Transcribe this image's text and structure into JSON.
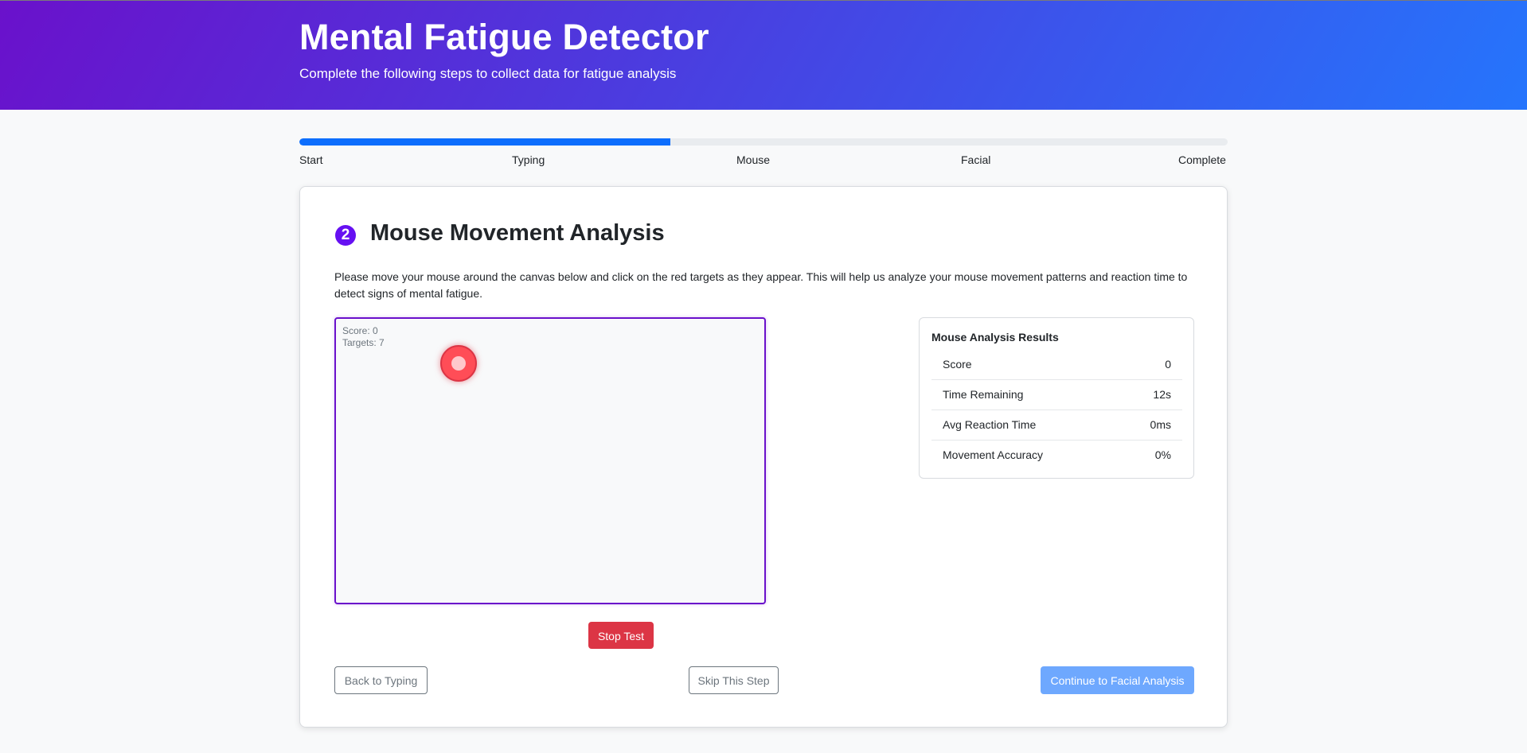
{
  "header": {
    "title": "Mental Fatigue Detector",
    "subtitle": "Complete the following steps to collect data for fatigue analysis"
  },
  "progress": {
    "percent": 40,
    "steps": [
      "Start",
      "Typing",
      "Mouse",
      "Facial",
      "Complete"
    ]
  },
  "section": {
    "step_number": "2",
    "title": "Mouse Movement Analysis",
    "description": "Please move your mouse around the canvas below and click on the red targets as they appear. This will help us analyze your mouse movement patterns and reaction time to detect signs of mental fatigue."
  },
  "canvas": {
    "score_text": "Score: 0",
    "targets_text": "Targets: 7",
    "border_color": "#6a11cb",
    "target_color": "#dc3545"
  },
  "results": {
    "title": "Mouse Analysis Results",
    "rows": [
      {
        "label": "Score",
        "value": "0"
      },
      {
        "label": "Time Remaining",
        "value": "12s"
      },
      {
        "label": "Avg Reaction Time",
        "value": "0ms"
      },
      {
        "label": "Movement Accuracy",
        "value": "0%"
      }
    ]
  },
  "buttons": {
    "stop": "Stop Test",
    "back": "Back to Typing",
    "skip": "Skip This Step",
    "continue": "Continue to Facial Analysis"
  },
  "colors": {
    "header_gradient_start": "#6a11cb",
    "header_gradient_end": "#2575fc",
    "progress_fill": "#0d6efd",
    "danger": "#dc3545",
    "primary_light": "#6ea8fe"
  }
}
